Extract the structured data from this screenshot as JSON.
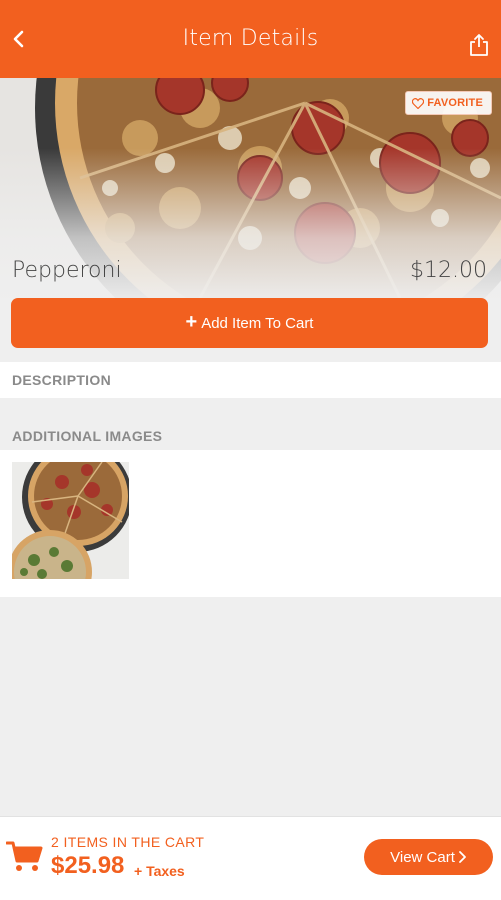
{
  "header": {
    "title": "Item Details",
    "back_icon": "chevron-left-icon",
    "share_icon": "share-icon"
  },
  "item": {
    "name": "Pepperoni",
    "price": "$12.00",
    "favorite_label": "FAVORITE",
    "add_to_cart_label": "Add Item To Cart"
  },
  "sections": {
    "description_title": "DESCRIPTION",
    "additional_images_title": "ADDITIONAL IMAGES"
  },
  "cart": {
    "count_label": "2 ITEMS IN THE CART",
    "total": "$25.98",
    "taxes_label": "+ Taxes",
    "view_cart_label": "View Cart"
  },
  "colors": {
    "accent": "#f2601f",
    "background": "#efefef"
  }
}
